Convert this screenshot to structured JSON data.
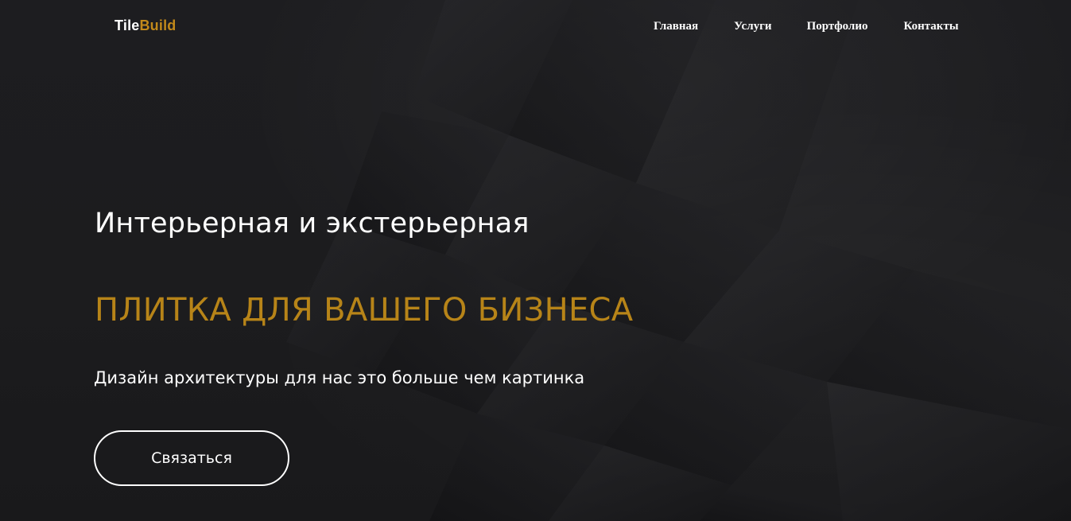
{
  "header": {
    "logo": {
      "part1": "Tile",
      "part2": "Build"
    },
    "nav": [
      {
        "label": "Главная"
      },
      {
        "label": "Услуги"
      },
      {
        "label": "Портфолио"
      },
      {
        "label": "Контакты"
      }
    ]
  },
  "hero": {
    "headline": "Интерьерная и экстерьерная",
    "subheadline": "ПЛИТКА ДЛЯ ВАШЕГО БИЗНЕСА",
    "tagline": "Дизайн архитектуры для нас это больше чем картинка",
    "cta_label": "Связаться"
  },
  "colors": {
    "background": "#1c1c1e",
    "accent": "#b78418",
    "text": "#ffffff"
  }
}
